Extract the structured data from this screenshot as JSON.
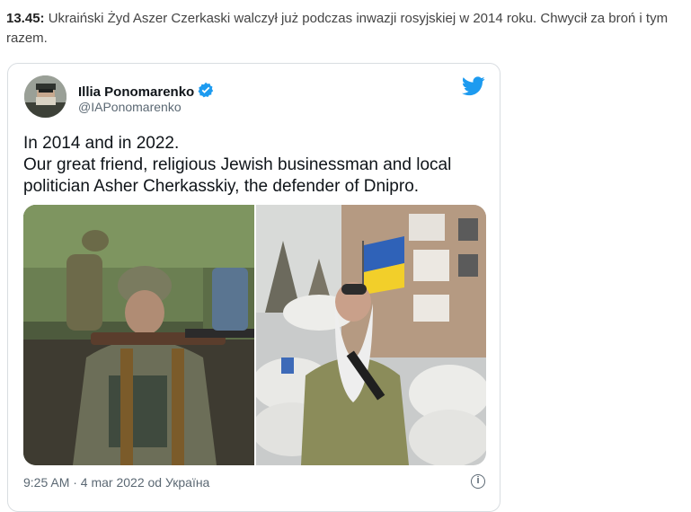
{
  "article": {
    "time": "13.45:",
    "lead_text": "Ukraiński Żyd Aszer Czerkaski walczył już podczas inwazji rosyjskiej w 2014 roku. Chwycił za broń i tym razem."
  },
  "tweet": {
    "author_name": "Illia Ponomarenko",
    "author_handle": "@IAPonomarenko",
    "verified_icon": "verified-badge-icon",
    "bird_icon": "twitter-bird-icon",
    "text_line1": "In 2014 and in 2022.",
    "text_line2": "Our great friend, religious Jewish businessman and local politician Asher Cherkasskiy, the defender of Dnipro.",
    "timestamp": "9:25 AM · 4 mar 2022 od Україна",
    "info_icon": "info-icon",
    "accent_color": "#1d9bf0"
  }
}
